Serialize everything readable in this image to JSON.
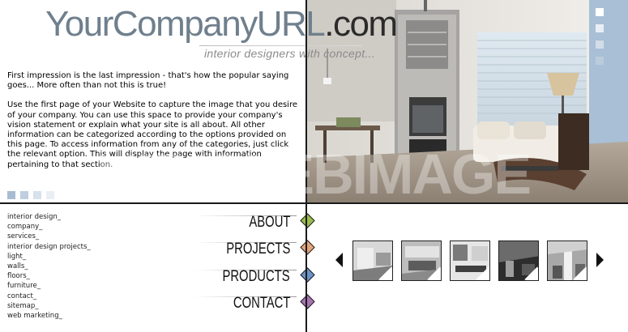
{
  "header": {
    "logo_main": "YourCompanyURL",
    "logo_suffix": ".com",
    "tagline": "interior designers with concept..."
  },
  "intro": {
    "paragraph1": "First impression is the last impression - that's how the popular saying goes... More often than not this is true!",
    "paragraph2": "Use the first page of your Website to capture the image that you desire of your company. You can use this space to provide your company's vision statement or explain what your site is all about. All other information can be categorized according to the options provided on this page. To access information from any of the categories, just click the relevant option. This will display the page with information pertaining to that section."
  },
  "hero": {
    "watermark": "NEWWEBIMAGE"
  },
  "links": [
    "interior design_",
    "company_",
    "services_",
    "interior design projects_",
    "light_",
    "walls_",
    "floors_",
    "furniture_",
    "contact_",
    "sitemap_",
    "web marketing_"
  ],
  "nav": [
    {
      "label": "ABOUT",
      "color": "#9bbd4e"
    },
    {
      "label": "PROJECTS",
      "color": "#e3a47a"
    },
    {
      "label": "PRODUCTS",
      "color": "#6a93c8"
    },
    {
      "label": "CONTACT",
      "color": "#a774b0"
    }
  ],
  "colors": {
    "accent_blue": "#a9bfd6",
    "square_left": [
      "#a8bcd1",
      "#bfcfdf",
      "#d6e1eb",
      "#e9eff5"
    ],
    "square_right": [
      "#ffffff",
      "#e8eef4",
      "#d2dde8",
      "#bccbdb"
    ]
  },
  "icons": {
    "prev": "triangle-left-icon",
    "next": "triangle-right-icon"
  }
}
